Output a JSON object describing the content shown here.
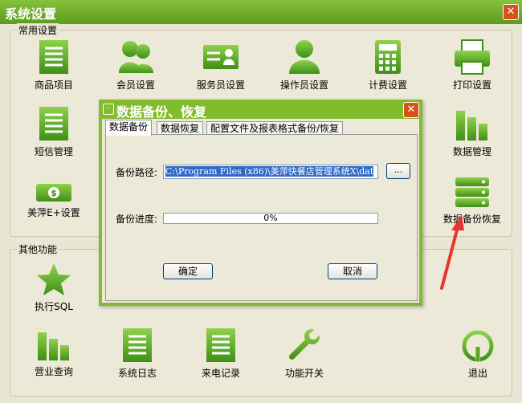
{
  "window": {
    "title": "系统设置",
    "close_icon": "close-icon"
  },
  "common": {
    "label": "常用设置",
    "items": [
      {
        "label": "商品项目",
        "icon": "list-icon"
      },
      {
        "label": "会员设置",
        "icon": "members-icon"
      },
      {
        "label": "服务员设置",
        "icon": "id-card-icon"
      },
      {
        "label": "操作员设置",
        "icon": "user-icon"
      },
      {
        "label": "计费设置",
        "icon": "calculator-icon"
      },
      {
        "label": "打印设置",
        "icon": "printer-icon"
      },
      {
        "label": "短信管理",
        "icon": "list-icon"
      },
      {
        "label": "数据管理",
        "icon": "bar-chart-icon"
      },
      {
        "label": "美萍E+设置",
        "icon": "money-icon"
      },
      {
        "label": "数据备份恢复",
        "icon": "database-icon"
      }
    ]
  },
  "other": {
    "label": "其他功能",
    "items": [
      {
        "label": "执行SQL",
        "icon": "star-icon"
      },
      {
        "label": "营业查询",
        "icon": "bar-chart-icon"
      },
      {
        "label": "系统日志",
        "icon": "list-icon"
      },
      {
        "label": "来电记录",
        "icon": "list-icon"
      },
      {
        "label": "功能开关",
        "icon": "wrench-icon"
      },
      {
        "label": "退出",
        "icon": "power-icon"
      }
    ]
  },
  "dialog": {
    "title": "数据备份、恢复",
    "tabs": [
      "数据备份",
      "数据恢复",
      "配置文件及报表格式备份/恢复"
    ],
    "backup_path_label": "备份路径:",
    "backup_path_value": "C:\\Program Files (x86)\\美萍快餐店管理系统X\\dat",
    "browse_label": "...",
    "progress_label": "备份进度:",
    "progress_text": "0%",
    "progress_value": 0,
    "ok_label": "确定",
    "cancel_label": "取消"
  },
  "colors": {
    "accent": "#6fae2b",
    "titlebar": "#74b02f",
    "close": "#d9501f",
    "annotation_arrow": "#e8352f",
    "selection": "#316ac5"
  }
}
